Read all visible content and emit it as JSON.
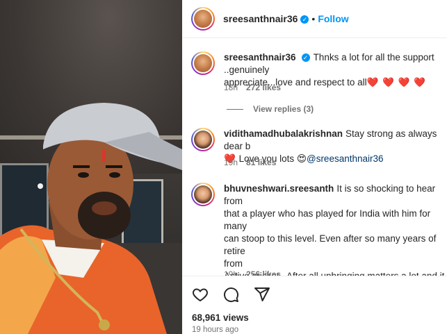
{
  "post": {
    "author": "sreesanthnair36",
    "follow_label": "Follow",
    "separator": "•"
  },
  "comments": [
    {
      "username": "sreesanthnair36",
      "text": "Thnks a lot for all the support ..genuinely\nappreciate...love and respect to all",
      "hearts": "❤️ ❤️ ❤️ ❤️",
      "time": "18h",
      "likes": "272 likes",
      "replies_label": "View replies (3)"
    },
    {
      "username": "vidithamadhubalakrishnan",
      "text": "Stay strong as always dear b",
      "text2": "Love you lots",
      "mention": "@sreesanthnair36",
      "time": "19h",
      "likes": "81 likes"
    },
    {
      "username": "bhuvneshwari.sreesanth",
      "text": "It is so shocking to hear from\nthat a player who has played for India with him for many\ncan stoop to this level. Even after so many years of retire\nfrom\nActive cricket . After all upbringing matters a lot and it sh\nup when these kind of behaviour comes up on ground.\nShocking truly shocking.",
      "time": "19h",
      "likes": "256 likes"
    }
  ],
  "footer": {
    "views": "68,961 views",
    "posted": "19 hours ago"
  },
  "icons": [
    "heart-icon",
    "comment-icon",
    "share-icon",
    "verified-badge-icon"
  ],
  "colors": {
    "accent": "#0095f6",
    "heart": "#ed4956",
    "secondary_text": "#737373"
  }
}
